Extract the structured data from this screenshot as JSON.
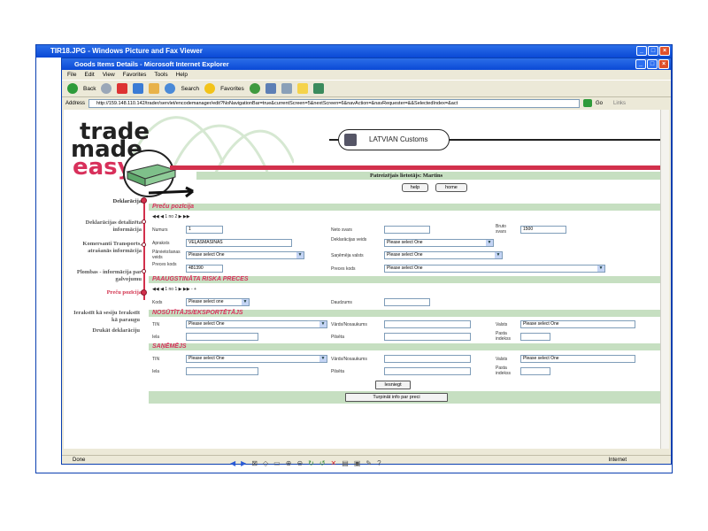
{
  "viewer": {
    "title": "TIR18.JPG - Windows Picture and Fax Viewer"
  },
  "ie": {
    "title": "Goods Items Details - Microsoft Internet Explorer",
    "menu": [
      "File",
      "Edit",
      "View",
      "Favorites",
      "Tools",
      "Help"
    ],
    "toolbar": {
      "back": "Back",
      "search": "Search",
      "favorites": "Favorites"
    },
    "address_label": "Address",
    "url": "http://159.148.110.142/trader/servlet/encodemanager/edit?NoNavigationBar=true&currentScreen=5&nextScreen=6&navAction=&navRequester=&&SelectedIndex=&act",
    "go": "Go",
    "links": "Links",
    "status_left": "Done",
    "status_right": "Internet"
  },
  "page": {
    "logo": {
      "line1": "trade",
      "line2": "made",
      "line3": "easy"
    },
    "customs": "LATVIAN Customs",
    "user": "Patreizējais lietotājs: Martins",
    "help_btn": "help",
    "home_btn": "home",
    "sidebar": [
      "Deklarācija",
      "Deklarācijas detalizēta informācija",
      "Komersanti Transports, atrašanās informācija",
      "Plombas - informācija par galvojumu",
      "Preču pozīcija",
      "Ierakstīt kā sesiju Ierakstīt kā paraugu",
      "Drukāt deklarāciju"
    ],
    "sections": {
      "preces": "Preču pozīcija",
      "risks": "PAAUGSTINĀTA RISKA PRECES",
      "sutitajs": "NOSŪTĪTĀJS/EKSPORTĒTĀJS",
      "sanemejs": "SAŅĒMĒJS"
    },
    "pager1": "1 no 2",
    "pager2": "1 no 1",
    "labels": {
      "numurs": "Numurs",
      "neto": "Neto svars",
      "bruto": "Bruto svars",
      "apraksts": "Apraksts",
      "deklar_veids": "Deklarācijas veids",
      "parvietosana": "Pārvietošanas veids",
      "sanemejvalsts": "Saņēmēja valsts",
      "preces_kods1": "Preces kods",
      "preces_kods2": "Preces kods",
      "kods": "Kods",
      "daudzums": "Daudzums",
      "tin": "TIN",
      "vards": "Vārds/Nosaukums",
      "valsts": "Valsts",
      "iela": "Iela",
      "pilseta": "Pilsēta",
      "pasta": "Pasta indekss"
    },
    "values": {
      "numurs": "1",
      "bruto": "1500",
      "apraksts": "VEĻASMAŠĪNAS",
      "preces_kods": "481390",
      "select": "Please select One",
      "kods_select": "Please select one"
    },
    "submit": "Iesniegt",
    "continue": "Turpināt info par preci"
  }
}
